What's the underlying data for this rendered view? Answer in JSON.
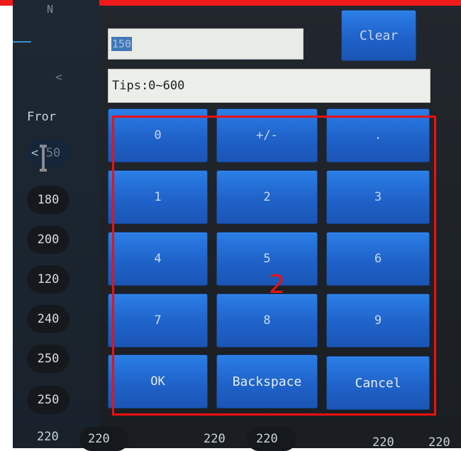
{
  "left_panel": {
    "header_letter": "N",
    "back_glyph": "<",
    "from_label": "Fror",
    "first_pill_text": "50",
    "back_glyph_small": "<",
    "values": [
      "180",
      "200",
      "120",
      "240",
      "250",
      "250",
      "220"
    ]
  },
  "bottom_row": [
    "220",
    "220",
    "220",
    "220",
    "220"
  ],
  "input": {
    "value": "150"
  },
  "tips": {
    "text": "Tips:0~600"
  },
  "buttons": {
    "clear": "Clear",
    "zero": "0",
    "plus_minus": "+/-",
    "dot": ".",
    "one": "1",
    "two": "2",
    "three": "3",
    "four": "4",
    "five": "5",
    "six": "6",
    "seven": "7",
    "eight": "8",
    "nine": "9",
    "ok": "OK",
    "backspace": "Backspace",
    "cancel": "Cancel"
  },
  "annotation": {
    "label": "2",
    "color": "#f20f10"
  },
  "colors": {
    "button_blue": "#1f62c9",
    "screen_bg": "#1e2328"
  }
}
